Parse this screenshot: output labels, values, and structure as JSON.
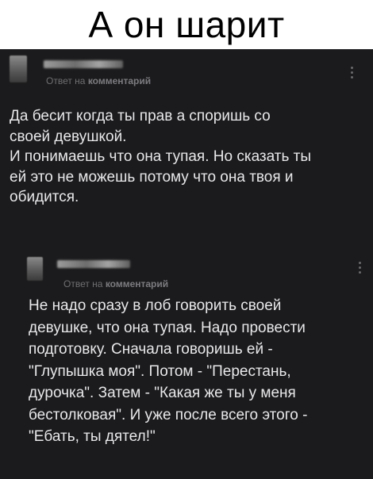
{
  "meme": {
    "title": "А он шарит"
  },
  "comments": [
    {
      "reply_prefix": "Ответ на",
      "reply_target": "комментарий",
      "text": "Да бесит когда ты прав а споришь со\nсвоей девушкой.\nИ понимаешь что она тупая. Но сказать ты\nей это не можешь потому что она твоя и\nобидится."
    },
    {
      "reply_prefix": "Ответ на",
      "reply_target": "комментарий",
      "text": "Не надо сразу в лоб говорить своей\nдевушке, что она тупая. Надо провести\nподготовку. Сначала говоришь ей -\n\"Глупышка моя\". Потом - \"Перестань,\nдурочка\". Затем - \"Какая же ты у меня\nбестолковая\". И уже после всего этого -\n\"Ебать, ты дятел!\""
    }
  ],
  "icons": {
    "more": "kebab-menu-icon"
  },
  "colors": {
    "background": "#1b1b1d",
    "text": "#e8e8ea",
    "meta": "#6f6f72",
    "header_bg": "#ffffff"
  }
}
